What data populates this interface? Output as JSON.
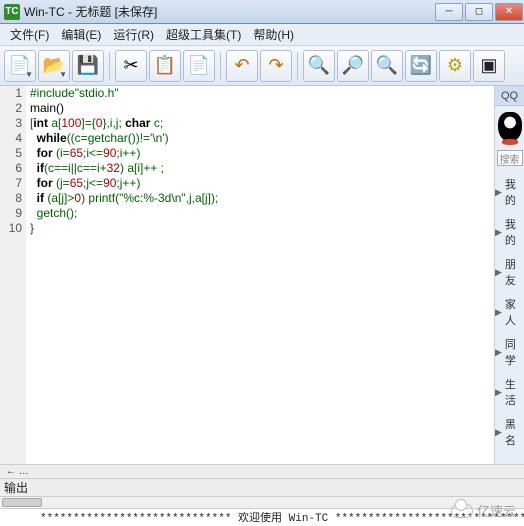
{
  "title": "Win-TC - 无标题 [未保存]",
  "menu": {
    "file": "文件(F)",
    "edit": "编辑(E)",
    "run": "运行(R)",
    "tools": "超级工具集(T)",
    "help": "帮助(H)"
  },
  "qq": {
    "head": "QQ",
    "search": "搜索",
    "items": [
      "我的",
      "我的",
      "朋友",
      "家人",
      "同学",
      "生活",
      "黑名"
    ]
  },
  "collapse": "← …",
  "output": {
    "label": "输出",
    "line": "*****************************  欢迎使用  Win-TC  ********************************"
  },
  "footer": "亿速云",
  "code_lines": [
    {
      "n": 1,
      "seg": [
        [
          "pre",
          "#include\"stdio.h\""
        ]
      ]
    },
    {
      "n": 2,
      "seg": [
        [
          "fn",
          "main()"
        ]
      ]
    },
    {
      "n": 3,
      "seg": [
        [
          "pre",
          "["
        ],
        [
          "kw",
          "int"
        ],
        [
          "pre",
          " a["
        ],
        [
          "num",
          "100"
        ],
        [
          "pre",
          "]={"
        ],
        [
          "num",
          "0"
        ],
        [
          "pre",
          "},i,j; "
        ],
        [
          "kw",
          "char"
        ],
        [
          "pre",
          " c;"
        ]
      ]
    },
    {
      "n": 4,
      "seg": [
        [
          "pre",
          "  "
        ],
        [
          "kw",
          "while"
        ],
        [
          "pre",
          "((c=getchar())!="
        ],
        [
          "str",
          "'\\n'"
        ],
        [
          "pre",
          ")"
        ]
      ]
    },
    {
      "n": 5,
      "seg": [
        [
          "pre",
          "  "
        ],
        [
          "kw",
          "for"
        ],
        [
          "pre",
          " (i="
        ],
        [
          "num",
          "65"
        ],
        [
          "pre",
          ";i<="
        ],
        [
          "num",
          "90"
        ],
        [
          "pre",
          ";i++)"
        ]
      ]
    },
    {
      "n": 6,
      "seg": [
        [
          "pre",
          "  "
        ],
        [
          "kw",
          "if"
        ],
        [
          "pre",
          "(c==i||c==i+"
        ],
        [
          "num",
          "32"
        ],
        [
          "pre",
          ") a[i]++ ;"
        ]
      ]
    },
    {
      "n": 7,
      "seg": [
        [
          "pre",
          "  "
        ],
        [
          "kw",
          "for"
        ],
        [
          "pre",
          " (j="
        ],
        [
          "num",
          "65"
        ],
        [
          "pre",
          ";j<="
        ],
        [
          "num",
          "90"
        ],
        [
          "pre",
          ";j++)"
        ]
      ]
    },
    {
      "n": 8,
      "seg": [
        [
          "pre",
          "  "
        ],
        [
          "kw",
          "if"
        ],
        [
          "pre",
          " (a[j]>"
        ],
        [
          "num",
          "0"
        ],
        [
          "pre",
          ") printf("
        ],
        [
          "str",
          "\"%c:%-3d\\n\""
        ],
        [
          "pre",
          ",j,a[j]);"
        ]
      ]
    },
    {
      "n": 9,
      "seg": [
        [
          "pre",
          "  getch();"
        ]
      ]
    },
    {
      "n": 10,
      "seg": [
        [
          "pre",
          "}"
        ]
      ]
    }
  ]
}
